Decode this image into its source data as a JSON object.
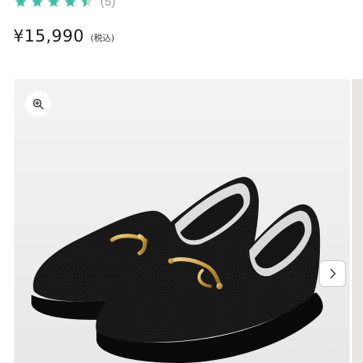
{
  "rating": {
    "stars_value": 4.5,
    "stars_max": 5,
    "count_label": "(5)",
    "star_color": "#3ebfa5",
    "empty_star_color": "#d3d3d3"
  },
  "price": {
    "amount": "¥15,990",
    "tax_note": "(税込)"
  },
  "gallery": {
    "product_image": "black-knit-loafers-with-gold-bit",
    "zoom_icon": "zoom-in-icon",
    "next_icon": "chevron-right-icon",
    "background_color": "#efefef"
  }
}
